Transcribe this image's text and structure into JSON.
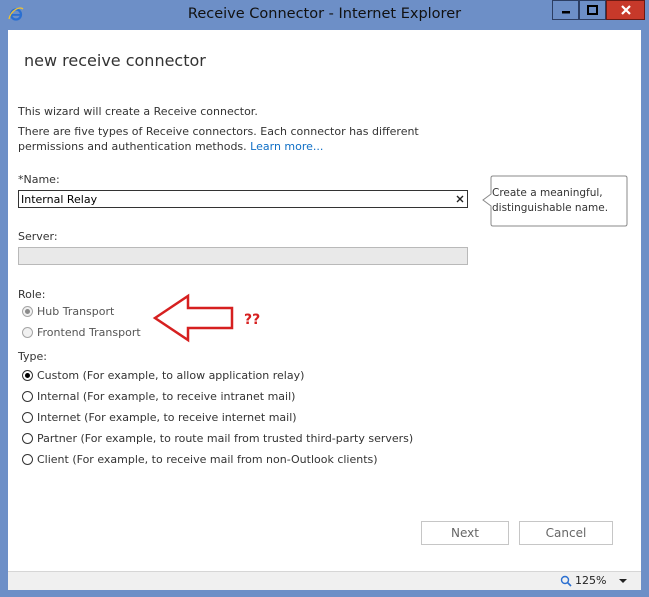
{
  "window": {
    "title": "Receive Connector - Internet Explorer",
    "icons": {
      "app": "ie-icon",
      "minimize": "minimize-icon",
      "maximize": "maximize-icon",
      "close": "close-icon"
    }
  },
  "page": {
    "title": "new receive connector",
    "intro": "This wizard will create a Receive connector.",
    "description": "There are five types of Receive connectors. Each connector has different permissions and authentication methods.",
    "learn_more": "Learn more..."
  },
  "form": {
    "name_label": "*Name:",
    "name_value": "Internal Relay",
    "name_tooltip": "Create a meaningful, distinguishable name.",
    "server_label": "Server:",
    "server_value": "",
    "role_label": "Role:",
    "roles": [
      {
        "label": "Hub Transport",
        "checked": true,
        "disabled": true
      },
      {
        "label": "Frontend Transport",
        "checked": false,
        "disabled": true
      }
    ],
    "type_label": "Type:",
    "types": [
      {
        "label": "Custom (For example, to allow application relay)",
        "checked": true
      },
      {
        "label": "Internal (For example, to receive intranet mail)",
        "checked": false
      },
      {
        "label": "Internet (For example, to receive internet mail)",
        "checked": false
      },
      {
        "label": "Partner (For example, to route mail from trusted third-party servers)",
        "checked": false
      },
      {
        "label": "Client (For example, to receive mail from non-Outlook clients)",
        "checked": false
      }
    ]
  },
  "annotation": {
    "text": "??",
    "color": "#d62020"
  },
  "buttons": {
    "next": "Next",
    "cancel": "Cancel"
  },
  "status": {
    "zoom": "125%"
  },
  "colors": {
    "titlebar": "#6d8fc7",
    "close": "#c7392a",
    "link": "#0f6fc6"
  }
}
